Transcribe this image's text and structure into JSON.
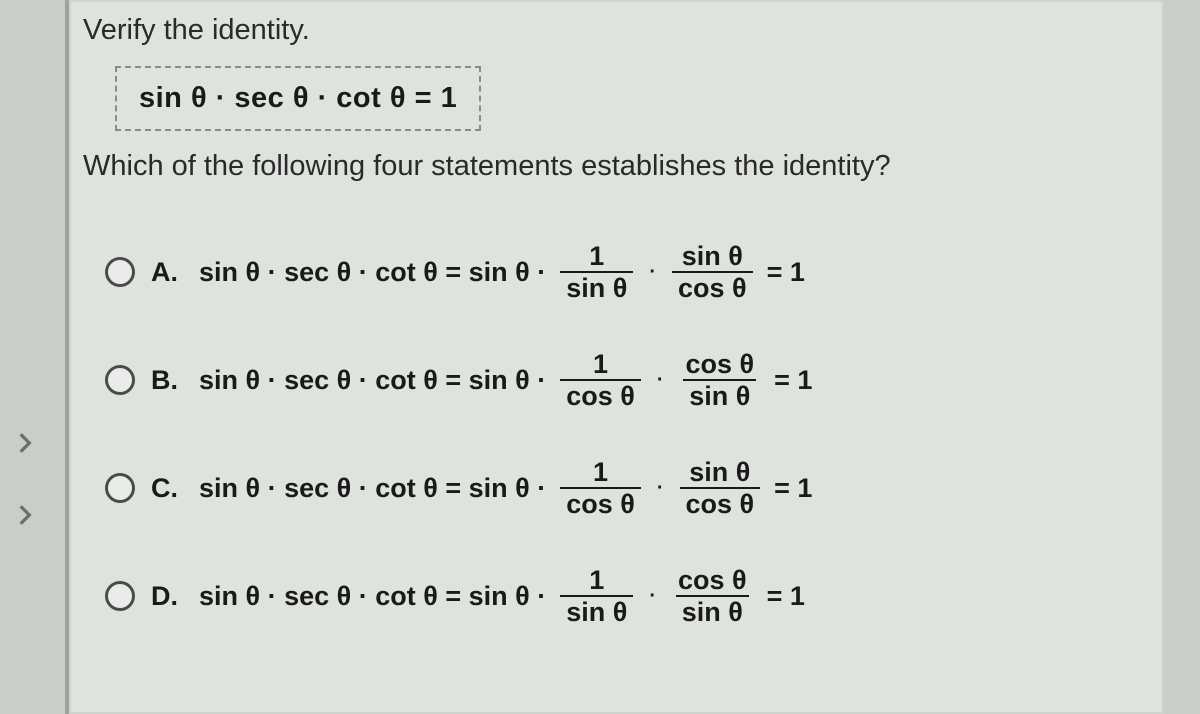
{
  "prompt_text": "Verify the identity.",
  "identity_expression": "sin θ · sec θ · cot θ = 1",
  "question_text": "Which of the following four statements establishes the identity?",
  "options": [
    {
      "label": "A.",
      "lhs": "sin θ · sec θ · cot θ = sin θ ·",
      "frac1_num": "1",
      "frac1_den": "sin θ",
      "dot": "·",
      "frac2_num": "sin θ",
      "frac2_den": "cos θ",
      "rhs": "= 1"
    },
    {
      "label": "B.",
      "lhs": "sin θ · sec θ · cot θ = sin θ ·",
      "frac1_num": "1",
      "frac1_den": "cos θ",
      "dot": "·",
      "frac2_num": "cos θ",
      "frac2_den": "sin θ",
      "rhs": "= 1"
    },
    {
      "label": "C.",
      "lhs": "sin θ · sec θ · cot θ = sin θ ·",
      "frac1_num": "1",
      "frac1_den": "cos θ",
      "dot": "·",
      "frac2_num": "sin θ",
      "frac2_den": "cos θ",
      "rhs": "= 1"
    },
    {
      "label": "D.",
      "lhs": "sin θ · sec θ · cot θ = sin θ ·",
      "frac1_num": "1",
      "frac1_den": "sin θ",
      "dot": "·",
      "frac2_num": "cos θ",
      "frac2_den": "sin θ",
      "rhs": "= 1"
    }
  ]
}
